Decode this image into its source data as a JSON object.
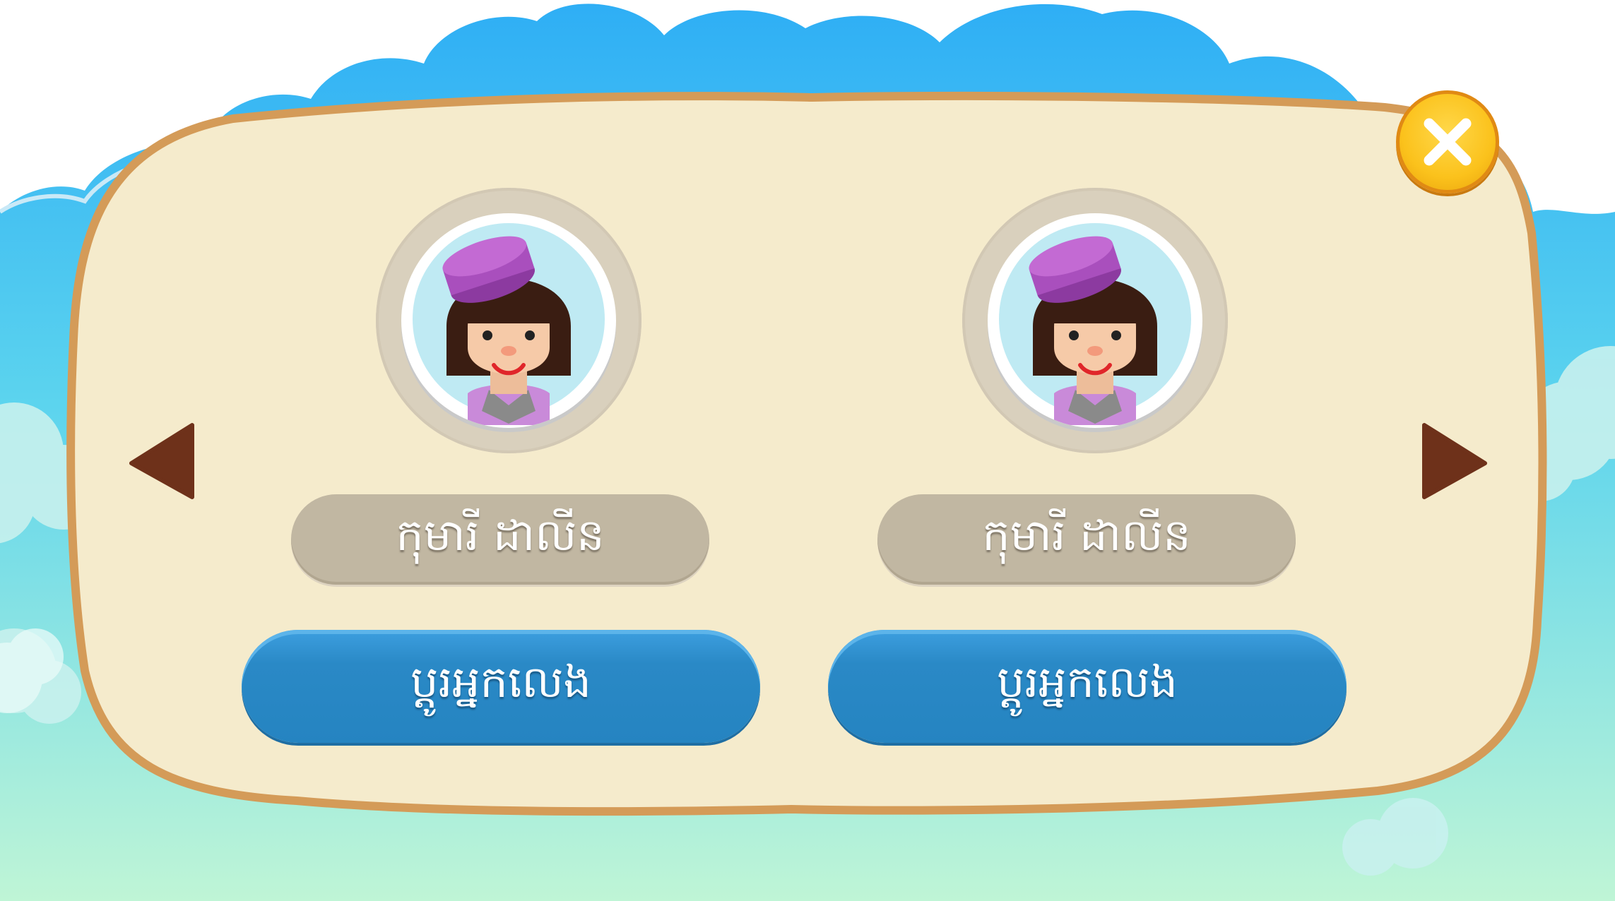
{
  "colors": {
    "sky": "#36b5f2",
    "panel": "#f5ebcc",
    "panel_border": "#d49b58",
    "name_plate": "#c1b7a2",
    "button_blue": "#2a89c6",
    "arrow": "#6e311a",
    "close_gold": "#fbc21c"
  },
  "icons": {
    "close": "close-x-icon",
    "prev": "triangle-left-icon",
    "next": "triangle-right-icon"
  },
  "players": [
    {
      "name": "កុមារី ដាលីន",
      "button_label": "ប្តូរអ្នកលេង"
    },
    {
      "name": "កុមារី ដាលីន",
      "button_label": "ប្តូរអ្នកលេង"
    }
  ]
}
